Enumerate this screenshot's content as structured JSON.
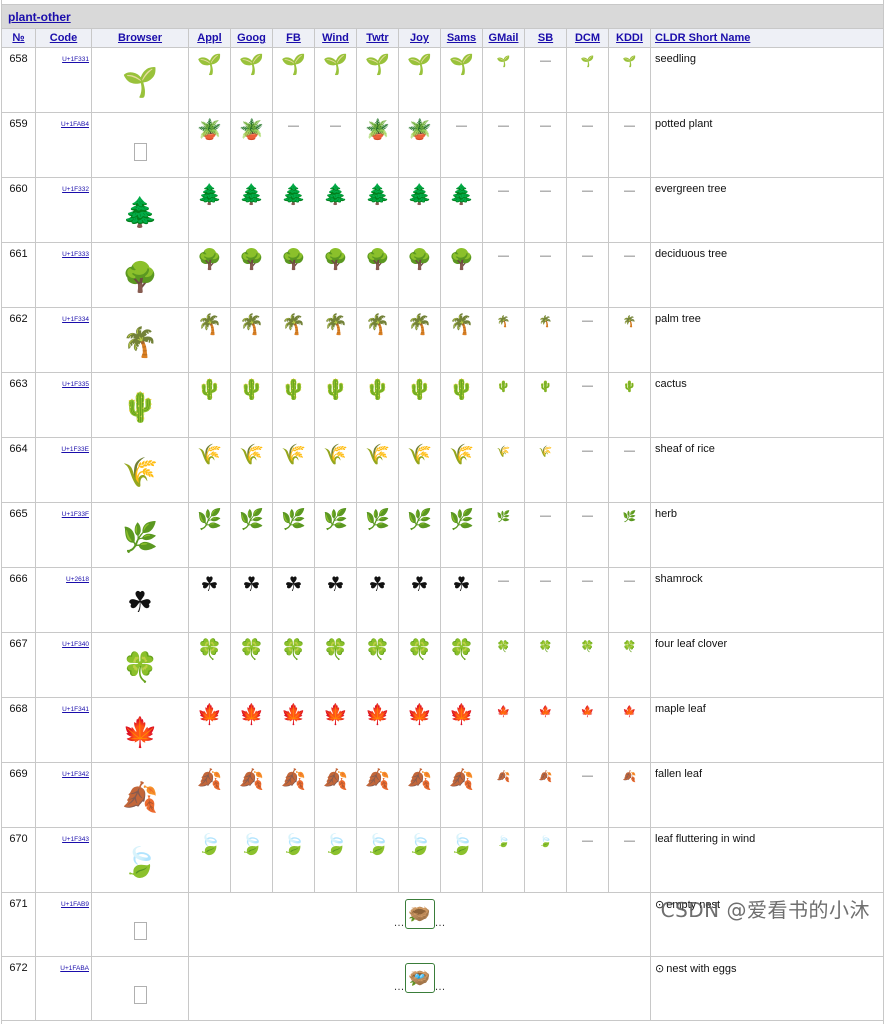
{
  "section": {
    "title": "plant-other"
  },
  "header": {
    "num": "№",
    "code": "Code",
    "browser": "Browser",
    "vendors": [
      "Appl",
      "Goog",
      "FB",
      "Wind",
      "Twtr",
      "Joy",
      "Sams",
      "GMail",
      "SB",
      "DCM",
      "KDDI"
    ],
    "name": "CLDR Short Name"
  },
  "dash": "—",
  "ellipsis": "…",
  "rows": [
    {
      "num": "658",
      "code": "U+1F331",
      "emoji": "🌱",
      "name": "seedling",
      "v": [
        "🌱",
        "🌱",
        "🌱",
        "🌱",
        "🌱",
        "🌱",
        "🌱",
        "🌱",
        "—",
        "🌱",
        "🌱"
      ]
    },
    {
      "num": "659",
      "code": "U+1FAB4",
      "emoji": "🪴",
      "tofu": true,
      "name": "potted plant",
      "v": [
        "🪴",
        "🪴",
        "—",
        "—",
        "🪴",
        "🪴",
        "—",
        "—",
        "—",
        "—",
        "—"
      ]
    },
    {
      "num": "660",
      "code": "U+1F332",
      "emoji": "🌲",
      "name": "evergreen tree",
      "v": [
        "🌲",
        "🌲",
        "🌲",
        "🌲",
        "🌲",
        "🌲",
        "🌲",
        "—",
        "—",
        "—",
        "—"
      ]
    },
    {
      "num": "661",
      "code": "U+1F333",
      "emoji": "🌳",
      "name": "deciduous tree",
      "v": [
        "🌳",
        "🌳",
        "🌳",
        "🌳",
        "🌳",
        "🌳",
        "🌳",
        "—",
        "—",
        "—",
        "—"
      ]
    },
    {
      "num": "662",
      "code": "U+1F334",
      "emoji": "🌴",
      "name": "palm tree",
      "v": [
        "🌴",
        "🌴",
        "🌴",
        "🌴",
        "🌴",
        "🌴",
        "🌴",
        "🌴",
        "🌴",
        "—",
        "🌴"
      ]
    },
    {
      "num": "663",
      "code": "U+1F335",
      "emoji": "🌵",
      "name": "cactus",
      "v": [
        "🌵",
        "🌵",
        "🌵",
        "🌵",
        "🌵",
        "🌵",
        "🌵",
        "🌵",
        "🌵",
        "—",
        "🌵"
      ]
    },
    {
      "num": "664",
      "code": "U+1F33E",
      "emoji": "🌾",
      "name": "sheaf of rice",
      "v": [
        "🌾",
        "🌾",
        "🌾",
        "🌾",
        "🌾",
        "🌾",
        "🌾",
        "🌾",
        "🌾",
        "—",
        "—"
      ]
    },
    {
      "num": "665",
      "code": "U+1F33F",
      "emoji": "🌿",
      "name": "herb",
      "v": [
        "🌿",
        "🌿",
        "🌿",
        "🌿",
        "🌿",
        "🌿",
        "🌿",
        "🌿",
        "—",
        "—",
        "🌿"
      ]
    },
    {
      "num": "666",
      "code": "U+2618",
      "emoji": "☘",
      "name": "shamrock",
      "v": [
        "☘",
        "☘",
        "☘",
        "☘",
        "☘",
        "☘",
        "☘",
        "—",
        "—",
        "—",
        "—"
      ]
    },
    {
      "num": "667",
      "code": "U+1F340",
      "emoji": "🍀",
      "name": "four leaf clover",
      "v": [
        "🍀",
        "🍀",
        "🍀",
        "🍀",
        "🍀",
        "🍀",
        "🍀",
        "🍀",
        "🍀",
        "🍀",
        "🍀"
      ]
    },
    {
      "num": "668",
      "code": "U+1F341",
      "emoji": "🍁",
      "name": "maple leaf",
      "v": [
        "🍁",
        "🍁",
        "🍁",
        "🍁",
        "🍁",
        "🍁",
        "🍁",
        "🍁",
        "🍁",
        "🍁",
        "🍁"
      ]
    },
    {
      "num": "669",
      "code": "U+1F342",
      "emoji": "🍂",
      "name": "fallen leaf",
      "v": [
        "🍂",
        "🍂",
        "🍂",
        "🍂",
        "🍂",
        "🍂",
        "🍂",
        "🍂",
        "🍂",
        "—",
        "🍂"
      ]
    },
    {
      "num": "670",
      "code": "U+1F343",
      "emoji": "🍃",
      "name": "leaf fluttering in wind",
      "v": [
        "🍃",
        "🍃",
        "🍃",
        "🍃",
        "🍃",
        "🍃",
        "🍃",
        "🍃",
        "🍃",
        "—",
        "—"
      ]
    },
    {
      "num": "671",
      "code": "U+1FAB9",
      "emoji": "🪹",
      "tofu": true,
      "merged": true,
      "new": "⊙",
      "name": "empty nest"
    },
    {
      "num": "672",
      "code": "U+1FABA",
      "emoji": "🪺",
      "tofu": true,
      "merged": true,
      "new": "⊙",
      "name": "nest with eggs"
    }
  ],
  "watermark": "CSDN @爱看书的小沐"
}
